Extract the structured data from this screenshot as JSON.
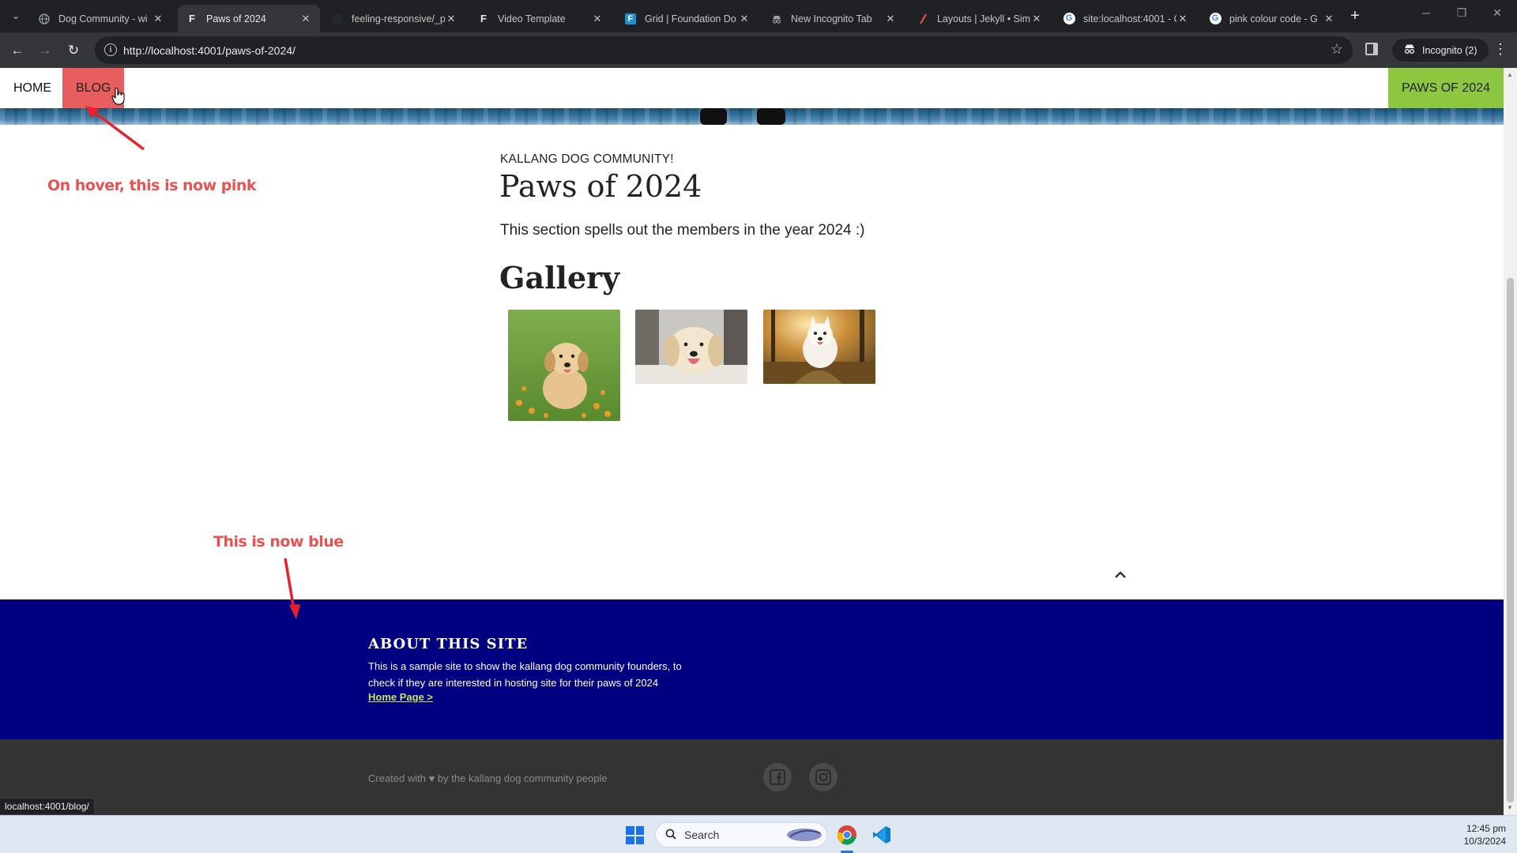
{
  "browser": {
    "tabs": [
      {
        "title": "Dog Community - wi",
        "favicon": "globe-icon",
        "active": false
      },
      {
        "title": "Paws of 2024",
        "favicon": "F",
        "active": true
      },
      {
        "title": "feeling-responsive/_p",
        "favicon": "github-icon",
        "active": false
      },
      {
        "title": "Video Template",
        "favicon": "F",
        "active": false
      },
      {
        "title": "Grid | Foundation Do",
        "favicon": "F",
        "active": false
      },
      {
        "title": "New Incognito Tab",
        "favicon": "incognito-icon",
        "active": false
      },
      {
        "title": "Layouts | Jekyll • Sim",
        "favicon": "jekyll-icon",
        "active": false
      },
      {
        "title": "site:localhost:4001 - C",
        "favicon": "G",
        "active": false
      },
      {
        "title": "pink colour code - G",
        "favicon": "G",
        "active": false
      }
    ],
    "url": "http://localhost:4001/paws-of-2024/",
    "incognito_label": "Incognito (2)",
    "status_url": "localhost:4001/blog/"
  },
  "site": {
    "nav": {
      "home": "HOME",
      "blog": "BLOG",
      "paws": "PAWS OF 2024"
    },
    "colors": {
      "blog_hover": "#e85d5d",
      "paws_active": "#8dc63f",
      "about_bg": "#000080",
      "footer_bg": "#333333"
    },
    "kicker": "KALLANG DOG COMMUNITY!",
    "title": "Paws of 2024",
    "description": "This section spells out the members in the year 2024 :)",
    "gallery_title": "Gallery",
    "about": {
      "heading": "ABOUT THIS SITE",
      "text": "This is a sample site to show the kallang dog community founders, to check if they are interested in hosting site for their paws of 2024",
      "link": "Home Page >"
    },
    "footer": {
      "credit": "Created with ♥ by the kallang dog community people",
      "social": [
        "facebook-icon",
        "instagram-icon"
      ]
    }
  },
  "annotations": {
    "hover_note": "On hover, this is now pink",
    "blue_note": "This is now blue"
  },
  "taskbar": {
    "search_placeholder": "Search",
    "time": "12:45 pm",
    "date": "10/3/2024"
  }
}
